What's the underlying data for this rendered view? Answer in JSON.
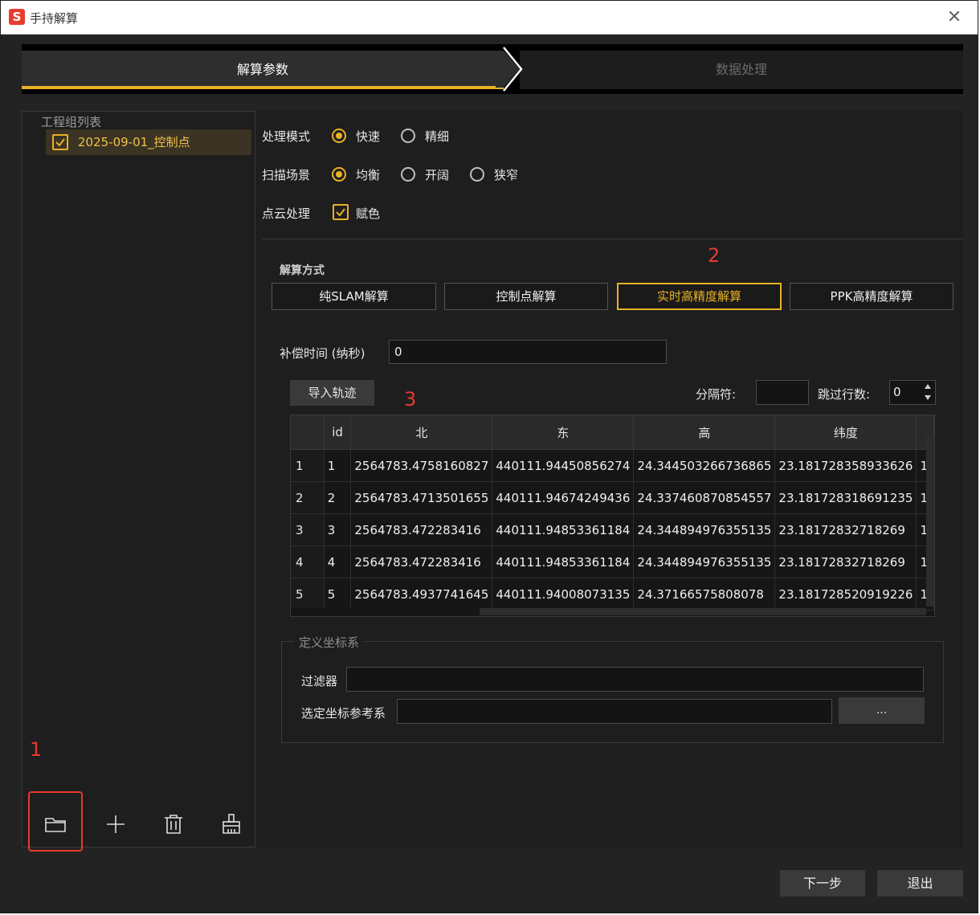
{
  "window": {
    "title": "手持解算",
    "app_icon": "S",
    "close_glyph": "✕"
  },
  "steps": [
    {
      "label": "解算参数",
      "active": true
    },
    {
      "label": "数据处理",
      "active": false
    }
  ],
  "left_panel": {
    "group_title": "工程组列表",
    "projects": [
      {
        "label": "2025-09-01_控制点",
        "checked": true
      }
    ],
    "toolbar_icons": [
      "folder-icon",
      "plus-icon",
      "trash-icon",
      "broom-icon"
    ]
  },
  "annotations": {
    "n1": "1",
    "n2": "2",
    "n3": "3",
    "color": "#e8392e"
  },
  "settings": {
    "mode": {
      "label": "处理模式",
      "options": [
        "快速",
        "精细"
      ],
      "selected": 0
    },
    "scene": {
      "label": "扫描场景",
      "options": [
        "均衡",
        "开阔",
        "狭窄"
      ],
      "selected": 0
    },
    "pointcloud": {
      "label": "点云处理",
      "checkbox_label": "赋色",
      "checked": true
    }
  },
  "method": {
    "title": "解算方式",
    "buttons": [
      "纯SLAM解算",
      "控制点解算",
      "实时高精度解算",
      "PPK高精度解算"
    ],
    "selected": 2
  },
  "compensation": {
    "label": "补偿时间 (纳秒)",
    "value": "0"
  },
  "trajectory": {
    "import_label": "导入轨迹",
    "separator_label": "分隔符:",
    "separator_value": "",
    "skip_label": "跳过行数:",
    "skip_value": "0",
    "columns": [
      "id",
      "北",
      "东",
      "高",
      "纬度"
    ],
    "rows": [
      {
        "num": "1",
        "cells": [
          "1",
          "2564783.4758160827",
          "440111.94450856274",
          "24.344503266736865",
          "23.181728358933626",
          "1"
        ]
      },
      {
        "num": "2",
        "cells": [
          "2",
          "2564783.4713501655",
          "440111.94674249436",
          "24.337460870854557",
          "23.181728318691235",
          "1"
        ]
      },
      {
        "num": "3",
        "cells": [
          "3",
          "2564783.472283416",
          "440111.94853361184",
          "24.344894976355135",
          "23.18172832718269",
          "1"
        ]
      },
      {
        "num": "4",
        "cells": [
          "4",
          "2564783.472283416",
          "440111.94853361184",
          "24.344894976355135",
          "23.18172832718269",
          "1"
        ]
      },
      {
        "num": "5",
        "cells": [
          "5",
          "2564783.4937741645",
          "440111.94008073135",
          "24.37166575808078",
          "23.181728520919226",
          "1"
        ]
      }
    ]
  },
  "coord": {
    "title": "定义坐标系",
    "filter_label": "过滤器",
    "filter_value": "",
    "ref_label": "选定坐标参考系",
    "ref_value": "",
    "browse_label": "..."
  },
  "footer": {
    "next_label": "下一步",
    "exit_label": "退出"
  },
  "colors": {
    "accent": "#e8b225",
    "background": "#232323",
    "panel": "#1e1e1e"
  }
}
